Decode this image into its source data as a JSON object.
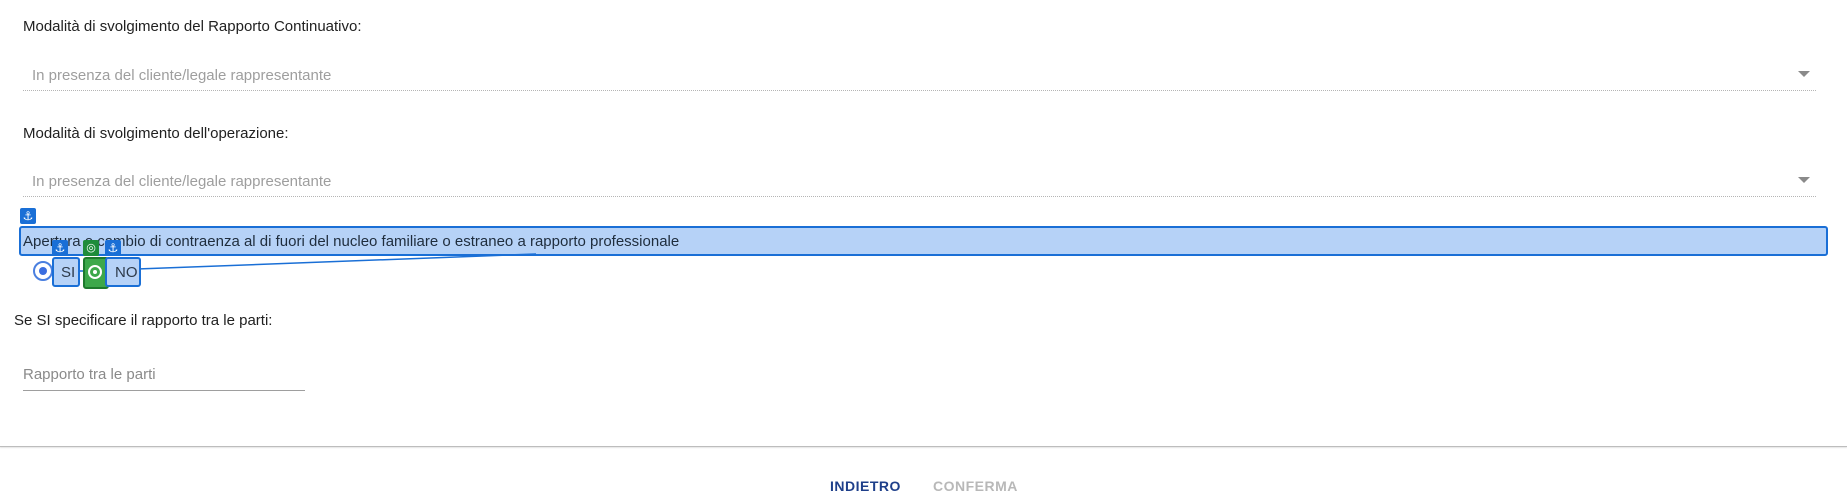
{
  "rapporto": {
    "label": "Modalità di svolgimento del Rapporto Continuativo:",
    "value": "In presenza del cliente/legale rappresentante"
  },
  "operazione": {
    "label": "Modalità di svolgimento dell'operazione:",
    "value": "In presenza del cliente/legale rappresentante"
  },
  "apertura": {
    "label": "Apertura o cambio di contraenza al di fuori del nucleo familiare o estraneo a rapporto professionale",
    "options": [
      {
        "label": "SI",
        "selected": true
      },
      {
        "label": "NO",
        "selected": false
      }
    ]
  },
  "relazione": {
    "label": "Se SI specificare il rapporto tra le parti:",
    "placeholder": "Rapporto tra le parti",
    "value": ""
  },
  "footer": {
    "back_label": "INDIETRO",
    "confirm_label": "CONFERMA"
  },
  "colors": {
    "accent": "#1e3f8a",
    "disabled": "#b8b8b8",
    "highlight_fill": "#b6d2f7",
    "highlight_border": "#1a6fd6",
    "target_green": "#3da84a"
  },
  "icons": {
    "annotation_anchor": "anchor-icon",
    "annotation_target": "target-icon",
    "dropdown": "caret-down-icon"
  }
}
